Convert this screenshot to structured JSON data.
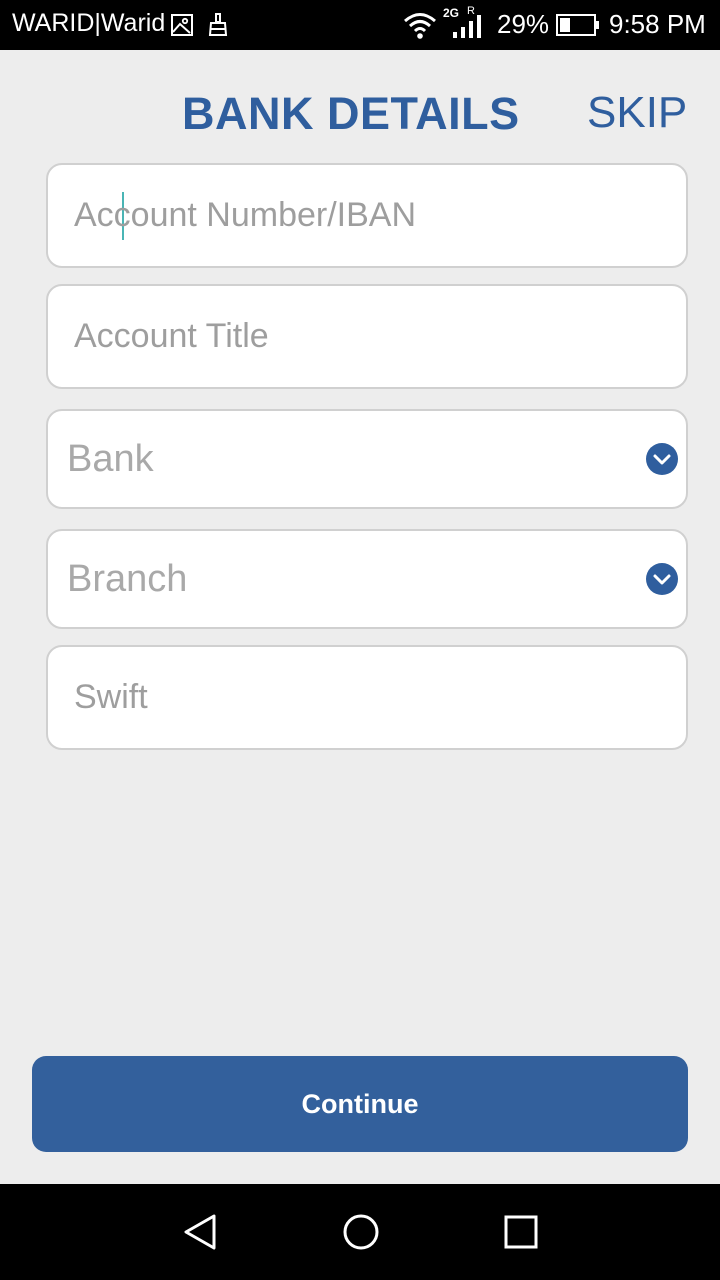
{
  "status_bar": {
    "carrier": "WARID|Warid",
    "network": "2G",
    "roaming": "R",
    "battery_percent": "29%",
    "time": "9:58 PM",
    "icons": [
      "gallery-icon",
      "clean-icon",
      "wifi-icon",
      "signal-icon",
      "battery-icon"
    ]
  },
  "header": {
    "title": "BANK DETAILS",
    "skip_label": "SKIP"
  },
  "form": {
    "account_number_placeholder": "Account Number/IBAN",
    "account_title_placeholder": "Account Title",
    "bank_label": "Bank",
    "branch_label": "Branch",
    "swift_placeholder": "Swift"
  },
  "continue_label": "Continue",
  "nav": {
    "icons": [
      "back-icon",
      "home-icon",
      "recent-apps-icon"
    ]
  },
  "colors": {
    "accent": "#2f5e9e",
    "button": "#33609c",
    "background": "#ededed"
  }
}
